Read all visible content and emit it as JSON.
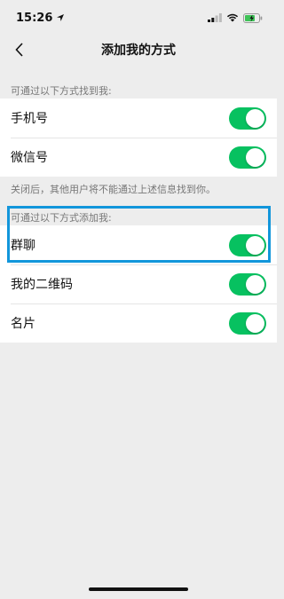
{
  "status": {
    "time": "15:26"
  },
  "nav": {
    "title": "添加我的方式"
  },
  "find_section": {
    "label": "可通过以下方式找到我:",
    "items": [
      {
        "label": "手机号",
        "enabled": true
      },
      {
        "label": "微信号",
        "enabled": true
      }
    ],
    "note": "关闭后，其他用户将不能通过上述信息找到你。"
  },
  "add_section": {
    "label": "可通过以下方式添加我:",
    "items": [
      {
        "label": "群聊",
        "enabled": true
      },
      {
        "label": "我的二维码",
        "enabled": true
      },
      {
        "label": "名片",
        "enabled": true
      }
    ]
  },
  "colors": {
    "toggle_on": "#07c160",
    "highlight": "#1296db",
    "background": "#ededed"
  }
}
